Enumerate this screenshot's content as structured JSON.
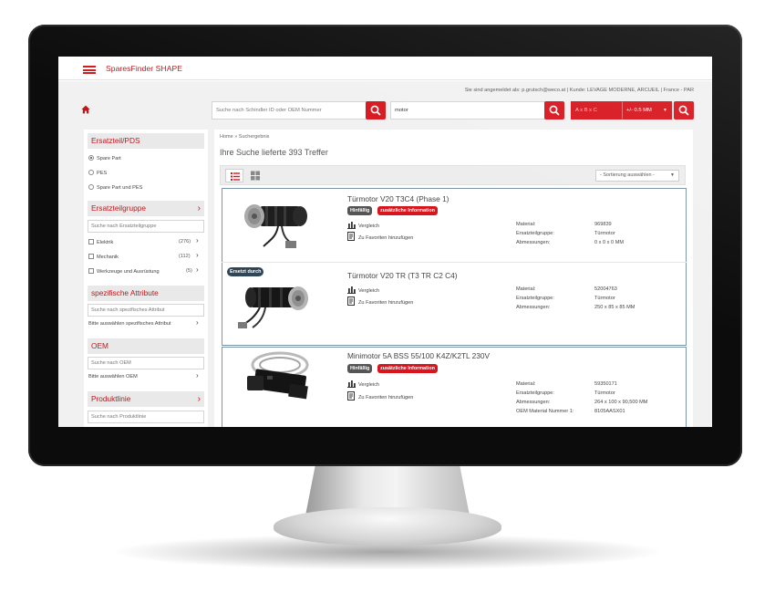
{
  "app": {
    "brand": "SparesFinder SHAPE"
  },
  "header": {
    "login_text": "Sie sind angemeldet als: p.grutsch@weco.at  |  Kunde:  LEVAGE MODERNE, ARCUEIL  |  France - PAR"
  },
  "search": {
    "id_placeholder": "Suche nach Schindler ID oder OEM Nummer",
    "text_value": "motor",
    "dimension_placeholder": "A x B x C",
    "tolerance_value": "+/- 0.5 MM"
  },
  "sidebar": {
    "ersatzteil_pds": {
      "title": "Ersatzteil/PDS",
      "options": [
        "Spare Part",
        "PES",
        "Spare Part und PES"
      ],
      "selected": "Spare Part"
    },
    "ersatzteilgruppe": {
      "title": "Ersatzteilgruppe",
      "search_placeholder": "Suche nach Ersatzteilgruppe",
      "items": [
        {
          "label": "Elektrik",
          "count": "(276)"
        },
        {
          "label": "Mechanik",
          "count": "(112)"
        },
        {
          "label": "Werkzeuge und Ausrüstung",
          "count": "(5)"
        }
      ]
    },
    "spezifische_attribute": {
      "title": "spezifische Attribute",
      "search_placeholder": "Suche nach spezifisches Attribut",
      "select_label": "Bitte auswählen spezifisches Attribut"
    },
    "oem": {
      "title": "OEM",
      "search_placeholder": "Suche nach OEM",
      "select_label": "Bitte auswählen OEM"
    },
    "produktlinie": {
      "title": "Produktlinie",
      "search_placeholder": "Suche nach Produktlinie"
    }
  },
  "main": {
    "breadcrumb": "Home » Suchergebnis",
    "result_title": "Ihre Suche lieferte 393 Treffer",
    "sort_label": "- Sortierung auswählen -",
    "actions": {
      "compare": "Vergleich",
      "favorite": "Zu Favoriten hinzufügen"
    },
    "products": [
      {
        "title": "Türmotor V20 T3C4 (Phase 1)",
        "badges": [
          "Hinfällig",
          "zusätzliche Information"
        ],
        "specs": [
          {
            "label": "Material:",
            "value": "969839"
          },
          {
            "label": "Ersatzteilgruppe:",
            "value": "Türmotor"
          },
          {
            "label": "Abmessungen:",
            "value": "0 x 0 x 0 MM"
          }
        ]
      },
      {
        "title": "Türmotor V20 TR (T3 TR C2 C4)",
        "corner_badge": "Ersetzt durch",
        "specs": [
          {
            "label": "Material:",
            "value": "52004763"
          },
          {
            "label": "Ersatzteilgruppe:",
            "value": "Türmotor"
          },
          {
            "label": "Abmessungen:",
            "value": "250 x 85 x 85 MM"
          }
        ]
      },
      {
        "title": "Minimotor 5A BSS 55/100 K4Z/K2TL 230V",
        "badges": [
          "Hinfällig",
          "zusätzliche Information"
        ],
        "specs": [
          {
            "label": "Material:",
            "value": "59350171"
          },
          {
            "label": "Ersatzteilgruppe:",
            "value": "Türmotor"
          },
          {
            "label": "Abmessungen:",
            "value": "264 x 100 x 90,500 MM"
          },
          {
            "label": "OEM Material Nummer 1:",
            "value": "8105AASX01"
          }
        ]
      }
    ]
  },
  "colors": {
    "accent": "#d8151d",
    "brand_text": "#c0171c",
    "navy_badge": "#2f4658"
  }
}
